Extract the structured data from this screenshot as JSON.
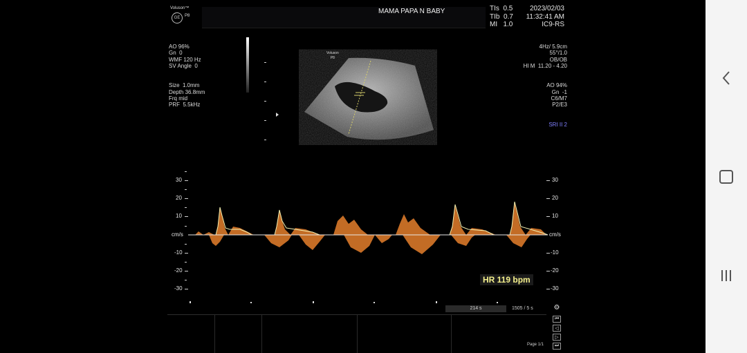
{
  "header": {
    "brand": "Voluson™",
    "model": "P8",
    "logo": "GE",
    "patient": "MAMA PAPA N BABY",
    "indices": [
      {
        "label": "TIs",
        "value": "0.5"
      },
      {
        "label": "TIb",
        "value": "0.7"
      },
      {
        "label": "MI",
        "value": "1.0"
      }
    ],
    "date": "2023/02/03",
    "time": "11:32:41 AM",
    "probe": "IC9-RS"
  },
  "left_params": [
    "AO 96%",
    "Gn  0",
    "WMF 120 Hz",
    "SV Angle  0",
    "Size  1.0mm",
    "Depth 36.8mm",
    "Frq mid",
    "PRF  5.5kHz"
  ],
  "right_params": [
    "4Hz/ 5.9cm",
    "55°/1.0",
    "OB/OB",
    "HI M  11.20 - 4.20",
    "AO 94%",
    "Gn  -1",
    "C6/M7",
    "P2/E3"
  ],
  "sri": "SRI II 2",
  "image_label": {
    "brand": "Voluson",
    "model": "P8"
  },
  "doppler": {
    "unit": "cm/s",
    "ticks": [
      "30",
      "20",
      "10",
      "-10",
      "-20",
      "-30"
    ],
    "heart_rate": "HR 119 bpm"
  },
  "footer": {
    "time_box": "214 s",
    "speed": "1505 / 5 s",
    "page": "Page 1/1"
  },
  "colors": {
    "doppler_orange": "#d9782a",
    "hr_box_bg": "#1b1b1b",
    "hr_box_text": "#f5f08c",
    "sri_blue": "#8080ff"
  },
  "icons": {
    "navbar": [
      "back-icon",
      "home-icon",
      "recent-apps-icon"
    ],
    "controls": [
      "gear-icon",
      "skip-back-icon",
      "step-back-icon",
      "play-icon",
      "skip-forward-icon"
    ]
  }
}
